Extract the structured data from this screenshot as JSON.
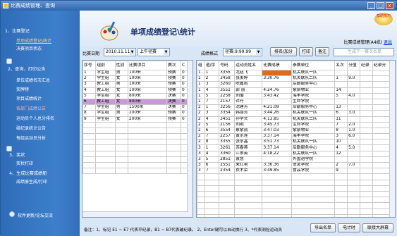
{
  "window": {
    "title": "比赛成绩管理、查询",
    "min": "_",
    "max": "□",
    "close": "x"
  },
  "sidebar": {
    "sections": [
      {
        "label": "1、比赛登记",
        "items": [
          {
            "label": "单项成绩登记\\统计",
            "active": true
          },
          {
            "label": "决赛项目状态"
          }
        ]
      },
      {
        "label": "2、查询、打印公告",
        "items": [
          {
            "label": "单位成绩名次汇总"
          },
          {
            "label": "奖牌榜"
          },
          {
            "label": "项目成绩统计"
          },
          {
            "label": "各部门成绩公告"
          },
          {
            "label": "运动员个人总分排名"
          },
          {
            "label": "破纪录统计公告"
          },
          {
            "label": "每组运动员分析"
          }
        ]
      },
      {
        "label": "3、奖状",
        "items": [
          {
            "label": "奖状打印"
          }
        ]
      },
      {
        "label": "4、生成比赛成绩册",
        "items": [
          {
            "label": "成绩册生成/打印"
          }
        ]
      }
    ],
    "bottom": "软件更新/论坛交流"
  },
  "header": {
    "title": "单项成绩登记\\统计",
    "help": "帮助技巧",
    "manager": "比赛成绩管理(A4纸)",
    "exit": "退出"
  },
  "toolbar": {
    "date_label": "比赛日期",
    "date_value": "2010.11.11",
    "session_value": "上午径赛",
    "format_label": "成绩格式",
    "format_value": "径赛:9:99.99",
    "rank_btn": "排名/加分",
    "print_btn": "打印",
    "backup_btn": "备注",
    "search_placeholder": "生成下一赛次名单"
  },
  "events": {
    "headers": [
      "序号",
      "组别",
      "性别",
      "比赛项目",
      "赛次",
      "C"
    ],
    "rows": [
      [
        "1",
        "学生组",
        "男",
        "100米",
        "预赛",
        "0"
      ],
      [
        "2",
        "学生组",
        "女",
        "100米",
        "预赛",
        "0"
      ],
      [
        "3",
        "教工组",
        "男",
        "100米",
        "预赛",
        "0"
      ],
      [
        "4",
        "教工组",
        "女",
        "100米",
        "预赛",
        "0"
      ],
      [
        "5",
        "学生组",
        "女",
        "800米",
        "决赛",
        "0"
      ],
      [
        "6",
        "教工组",
        "女",
        "800米",
        "决赛",
        "0"
      ],
      [
        "7",
        "学生组",
        "男",
        "1500米",
        "决赛",
        "0"
      ],
      [
        "8",
        "学生组",
        "男",
        "200米",
        "预赛",
        "0"
      ],
      [
        "9",
        "学生组",
        "女",
        "200米",
        "预赛",
        "0"
      ]
    ],
    "selected": 5
  },
  "results": {
    "headers": [
      "组",
      "道/序",
      "号码",
      "运动员姓名",
      "比赛成绩",
      "参赛单位",
      "名次",
      "分值",
      "纪录",
      "纪录分"
    ],
    "rows": [
      [
        "1",
        "1",
        "3355",
        "龙廷飞",
        "",
        "机关联队一队",
        "",
        "",
        "",
        ""
      ],
      [
        "1",
        "2",
        "3458",
        "张美婷",
        "3:30.76",
        "机关联队二队",
        "1",
        "9.0",
        "",
        ""
      ],
      [
        "1",
        "3",
        "3260",
        "陈嘉雨",
        "",
        "后勤服务中心",
        "",
        "",
        "",
        ""
      ],
      [
        "1",
        "4",
        "3551",
        "郭  丽",
        "4:24.76",
        "紫泉物业",
        "14",
        "",
        "",
        ""
      ],
      [
        "1",
        "5",
        "2258",
        "刘瑜",
        "3:43.42",
        "海丰学院",
        "5",
        "4.0",
        "",
        ""
      ],
      [
        "1",
        "7",
        "2157",
        "许丹",
        "",
        "生命学院",
        "",
        "",
        "",
        ""
      ],
      [
        "2",
        "1",
        "3256",
        "沈建芳",
        "4:21.08",
        "后勤服务中心",
        "13",
        "",
        "",
        ""
      ],
      [
        "2",
        "3",
        "3354",
        "韩丽芳",
        "3:44.26",
        "机关联队一队",
        "6",
        "3.0",
        "",
        ""
      ],
      [
        "2",
        "4",
        "3451",
        "孙学文",
        "4:13.85",
        "机关联队二队",
        "11",
        "",
        "",
        ""
      ],
      [
        "2",
        "5",
        "2156",
        "刘艳",
        "3:45.73",
        "生命学院",
        "7",
        "2.0",
        "",
        ""
      ],
      [
        "2",
        "6",
        "3554",
        "蔡紫丽",
        "3:47.03",
        "紫泉物业",
        "8",
        "1.0",
        "",
        ""
      ],
      [
        "2",
        "7",
        "2257",
        "黄水莲",
        "3:37.14",
        "海丰学院",
        "3",
        "6.0",
        "",
        ""
      ],
      [
        "2",
        "8",
        "3355",
        "张水晶",
        "3:51.73",
        "机关联队一队",
        "10",
        "",
        "",
        ""
      ],
      [
        "3",
        "1",
        "3261",
        "苏春燕",
        "3:37.14",
        "后勤服务中心",
        "4",
        "5.0",
        "",
        ""
      ],
      [
        "3",
        "4",
        "3360",
        "江翠英",
        "4:18.22",
        "机关联队一队",
        "12",
        "",
        "",
        ""
      ],
      [
        "3",
        "5",
        "2851",
        "袁慧",
        "",
        "外国语学院",
        "",
        "",
        "",
        ""
      ],
      [
        "3",
        "6",
        "2551",
        "朱红艳",
        "3:36.36",
        "信息学院",
        "2",
        "7.0",
        "",
        ""
      ],
      [
        "3",
        "7",
        "2354",
        "衣木荣",
        "3:49.85",
        "食品学院",
        "9",
        "",
        "",
        ""
      ]
    ]
  },
  "footer": {
    "note": "备注：1、标记 E1 ~ E7 代表平纪录，B1 ~ B7代表破纪录。  2、Enter键可以自动换行  3、*代表测验运动员",
    "export_btn": "导出名单",
    "timer_btn": "电计时",
    "screen_btn": "联接大屏幕"
  },
  "colors": {
    "sidebar": "#3d7fcc",
    "highlight": "#c79ad6",
    "result_mark": "#e06a1c",
    "title": "#1a2f6b"
  }
}
